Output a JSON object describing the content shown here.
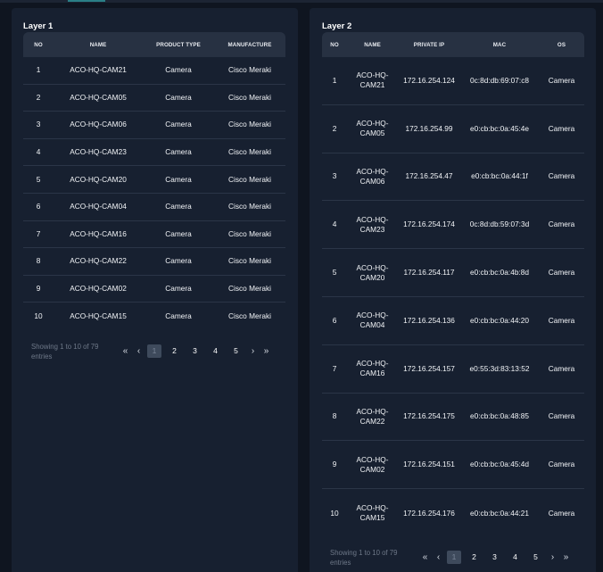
{
  "layer1": {
    "title": "Layer 1",
    "headers": [
      "NO",
      "NAME",
      "PRODUCT TYPE",
      "MANUFACTURE"
    ],
    "rows": [
      {
        "no": "1",
        "name": "ACO-HQ-CAM21",
        "type": "Camera",
        "manufacture": "Cisco Meraki"
      },
      {
        "no": "2",
        "name": "ACO-HQ-CAM05",
        "type": "Camera",
        "manufacture": "Cisco Meraki"
      },
      {
        "no": "3",
        "name": "ACO-HQ-CAM06",
        "type": "Camera",
        "manufacture": "Cisco Meraki"
      },
      {
        "no": "4",
        "name": "ACO-HQ-CAM23",
        "type": "Camera",
        "manufacture": "Cisco Meraki"
      },
      {
        "no": "5",
        "name": "ACO-HQ-CAM20",
        "type": "Camera",
        "manufacture": "Cisco Meraki"
      },
      {
        "no": "6",
        "name": "ACO-HQ-CAM04",
        "type": "Camera",
        "manufacture": "Cisco Meraki"
      },
      {
        "no": "7",
        "name": "ACO-HQ-CAM16",
        "type": "Camera",
        "manufacture": "Cisco Meraki"
      },
      {
        "no": "8",
        "name": "ACO-HQ-CAM22",
        "type": "Camera",
        "manufacture": "Cisco Meraki"
      },
      {
        "no": "9",
        "name": "ACO-HQ-CAM02",
        "type": "Camera",
        "manufacture": "Cisco Meraki"
      },
      {
        "no": "10",
        "name": "ACO-HQ-CAM15",
        "type": "Camera",
        "manufacture": "Cisco Meraki"
      }
    ],
    "showing": "Showing 1 to 10 of 79 entries",
    "pagination": {
      "first": "«",
      "prev": "‹",
      "pages": [
        "1",
        "2",
        "3",
        "4",
        "5"
      ],
      "next": "›",
      "last": "»",
      "active": "1"
    }
  },
  "layer2": {
    "title": "Layer 2",
    "headers": [
      "NO",
      "NAME",
      "PRIVATE IP",
      "MAC",
      "OS"
    ],
    "rows": [
      {
        "no": "1",
        "name": "ACO-HQ-CAM21",
        "ip": "172.16.254.124",
        "mac": "0c:8d:db:69:07:c8",
        "os": "Camera"
      },
      {
        "no": "2",
        "name": "ACO-HQ-CAM05",
        "ip": "172.16.254.99",
        "mac": "e0:cb:bc:0a:45:4e",
        "os": "Camera"
      },
      {
        "no": "3",
        "name": "ACO-HQ-CAM06",
        "ip": "172.16.254.47",
        "mac": "e0:cb:bc:0a:44:1f",
        "os": "Camera"
      },
      {
        "no": "4",
        "name": "ACO-HQ-CAM23",
        "ip": "172.16.254.174",
        "mac": "0c:8d:db:59:07:3d",
        "os": "Camera"
      },
      {
        "no": "5",
        "name": "ACO-HQ-CAM20",
        "ip": "172.16.254.117",
        "mac": "e0:cb:bc:0a:4b:8d",
        "os": "Camera"
      },
      {
        "no": "6",
        "name": "ACO-HQ-CAM04",
        "ip": "172.16.254.136",
        "mac": "e0:cb:bc:0a:44:20",
        "os": "Camera"
      },
      {
        "no": "7",
        "name": "ACO-HQ-CAM16",
        "ip": "172.16.254.157",
        "mac": "e0:55:3d:83:13:52",
        "os": "Camera"
      },
      {
        "no": "8",
        "name": "ACO-HQ-CAM22",
        "ip": "172.16.254.175",
        "mac": "e0:cb:bc:0a:48:85",
        "os": "Camera"
      },
      {
        "no": "9",
        "name": "ACO-HQ-CAM02",
        "ip": "172.16.254.151",
        "mac": "e0:cb:bc:0a:45:4d",
        "os": "Camera"
      },
      {
        "no": "10",
        "name": "ACO-HQ-CAM15",
        "ip": "172.16.254.176",
        "mac": "e0:cb:bc:0a:44:21",
        "os": "Camera"
      }
    ],
    "showing": "Showing 1 to 10 of 79 entries",
    "pagination": {
      "first": "«",
      "prev": "‹",
      "pages": [
        "1",
        "2",
        "3",
        "4",
        "5"
      ],
      "next": "›",
      "last": "»",
      "active": "1"
    }
  },
  "colors": {
    "background": "#0f1520",
    "panel": "#172030",
    "header": "#273142",
    "accent": "#2a7f86"
  }
}
